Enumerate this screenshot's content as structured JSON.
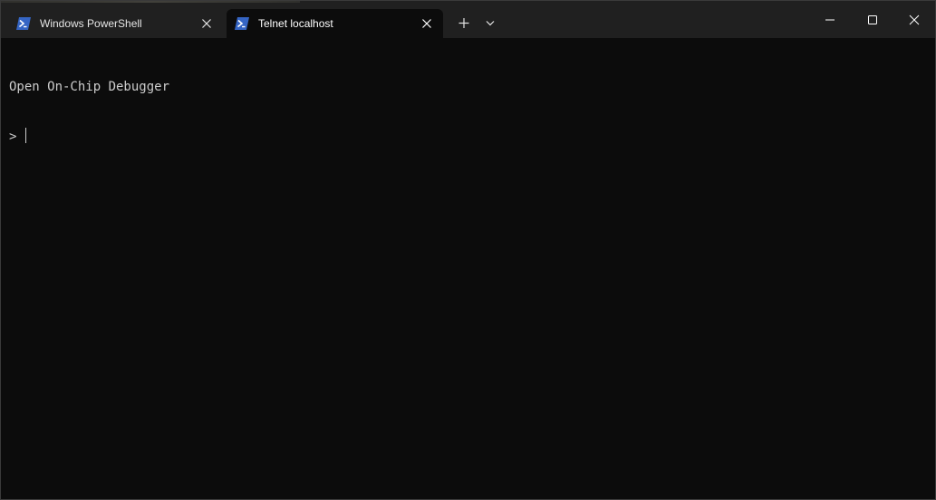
{
  "tabs": [
    {
      "title": "Windows PowerShell",
      "icon": "powershell-icon",
      "active": false
    },
    {
      "title": "Telnet localhost",
      "icon": "powershell-icon",
      "active": true
    }
  ],
  "titlebar": {
    "new_tab_icon": "plus-icon",
    "dropdown_icon": "chevron-down-icon",
    "minimize_icon": "minimize-icon",
    "maximize_icon": "maximize-icon",
    "close_icon": "close-icon"
  },
  "terminal": {
    "lines": [
      "Open On-Chip Debugger"
    ],
    "prompt": "> ",
    "input": ""
  },
  "colors": {
    "titlebar_bg": "#202020",
    "terminal_bg": "#0c0c0c",
    "terminal_fg": "#cccccc",
    "powershell_blue": "#3565c4"
  }
}
